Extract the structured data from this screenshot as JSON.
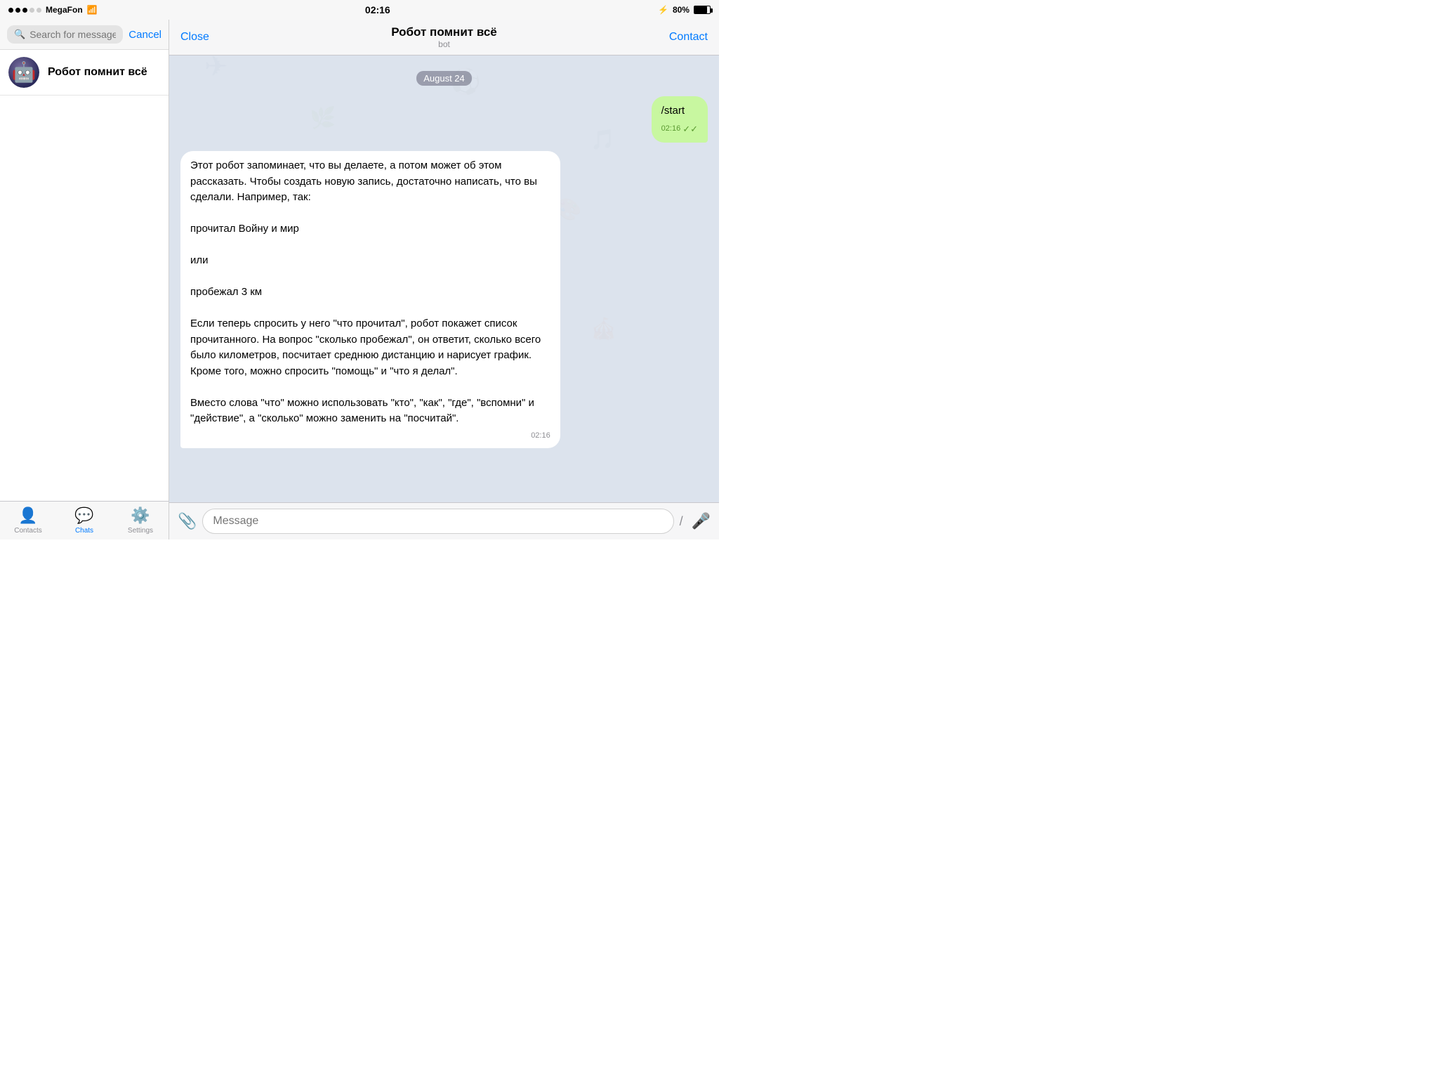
{
  "statusBar": {
    "carrier": "MegaFon",
    "time": "02:16",
    "battery": "80%",
    "bluetooth": "BT"
  },
  "leftPanel": {
    "searchPlaceholder": "Search for messages or users",
    "cancelLabel": "Cancel",
    "chatList": [
      {
        "name": "Робот помнит всё",
        "id": "robot-chat"
      }
    ]
  },
  "tabBar": {
    "tabs": [
      {
        "id": "contacts",
        "label": "Contacts",
        "icon": "👤"
      },
      {
        "id": "chats",
        "label": "Chats",
        "icon": "💬",
        "active": true
      },
      {
        "id": "settings",
        "label": "Settings",
        "icon": "⚙️"
      }
    ]
  },
  "chatPanel": {
    "header": {
      "closeLabel": "Close",
      "contactLabel": "Contact",
      "title": "Робот помнит всё",
      "subtitle": "bot"
    },
    "dateBadge": "August 24",
    "messages": [
      {
        "id": "msg-out-1",
        "type": "outgoing",
        "text": "/start",
        "time": "02:16",
        "read": true
      },
      {
        "id": "msg-in-1",
        "type": "incoming",
        "text": "Этот робот запоминает, что вы делаете, а потом может об этом рассказать. Чтобы создать новую запись, достаточно написать, что вы сделали. Например, так:\n\nпрочитал Войну и мир\n\nили\n\nпробежал 3 км\n\nЕсли теперь спросить у него \"что прочитал\", робот покажет список прочитанного. На вопрос \"сколько пробежал\", он ответит, сколько всего было километров, посчитает среднюю дистанцию и нарисует график. Кроме того, можно спросить \"помощь\" и \"что я делал\".\n\nВместо слова \"что\" можно использовать \"кто\", \"как\", \"где\", \"вспомни\" и \"действие\", а \"сколько\" можно заменить на \"посчитай\".",
        "time": "02:16",
        "read": false
      }
    ],
    "inputPlaceholder": "Message"
  }
}
